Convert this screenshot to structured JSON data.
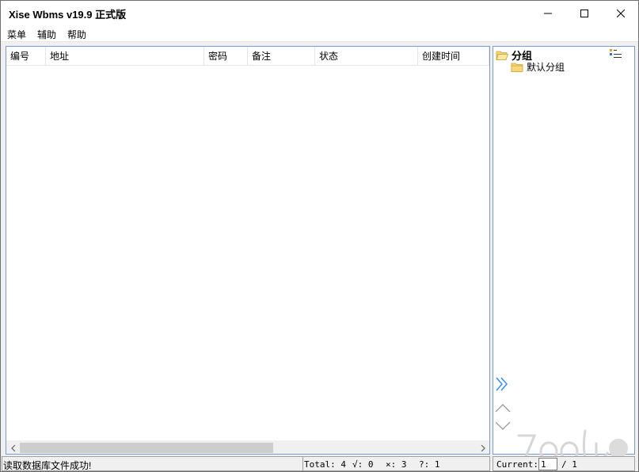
{
  "window": {
    "title": "Xise Wbms v19.9 正式版"
  },
  "menu": {
    "items": [
      "菜单",
      "辅助",
      "帮助"
    ]
  },
  "list": {
    "columns": [
      "编号",
      "地址",
      "密码",
      "备注",
      "状态",
      "创建时间"
    ],
    "rows": []
  },
  "groups": {
    "root_label": "分组",
    "items": [
      "默认分组"
    ]
  },
  "status": {
    "message": "读取数据库文件成功!",
    "total": "Total: 4",
    "ok": "√: 0",
    "fail": "×: 3",
    "unknown": "?: 1"
  },
  "pager": {
    "label": "Current:",
    "current": "1",
    "total": "/ 1"
  },
  "colors": {
    "panel_border": "#7a9cc8",
    "folder": "#f0c050",
    "accent_arrow": "#3a8ee6"
  },
  "icons": {
    "minimize": "minimize-icon",
    "maximize": "maximize-icon",
    "close": "close-icon",
    "folder": "folder-icon",
    "tree_toggle": "list-toggle-icon",
    "expand_arrows": "double-chevron-right-icon",
    "scroll_up": "chevron-up-icon",
    "scroll_down": "chevron-down-icon"
  }
}
